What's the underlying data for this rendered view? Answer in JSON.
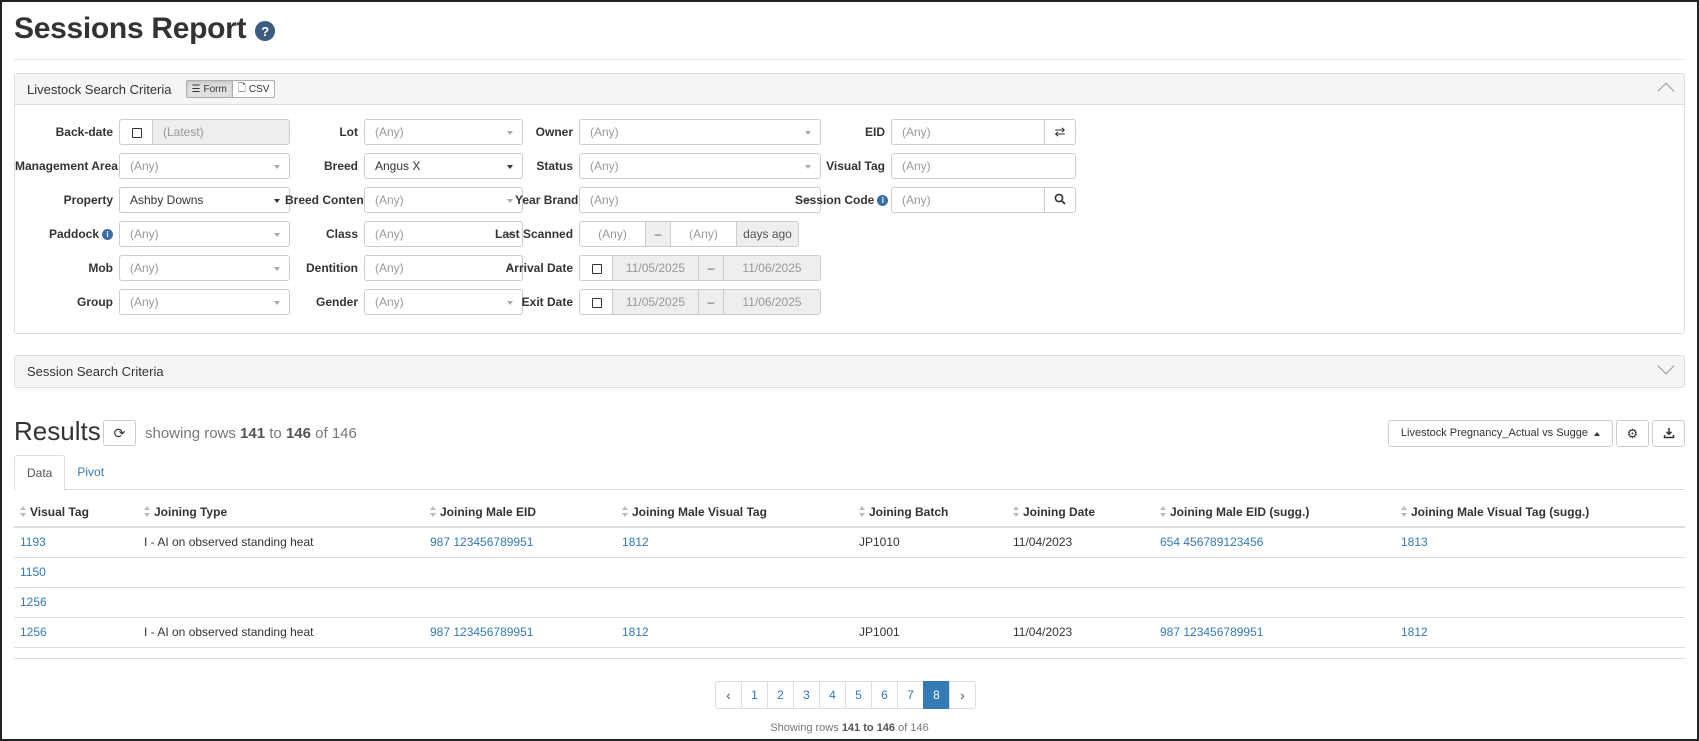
{
  "page": {
    "title": "Sessions Report",
    "help": "?"
  },
  "livestock_panel": {
    "title": "Livestock Search Criteria",
    "format_form": "Form",
    "format_csv": "CSV",
    "fields": {
      "backdate": {
        "label": "Back-date",
        "value": "(Latest)"
      },
      "management_area": {
        "label": "Management Area",
        "value": "(Any)"
      },
      "property": {
        "label": "Property",
        "value": "Ashby Downs"
      },
      "paddock": {
        "label": "Paddock",
        "value": "(Any)"
      },
      "mob": {
        "label": "Mob",
        "value": "(Any)"
      },
      "group": {
        "label": "Group",
        "value": "(Any)"
      },
      "lot": {
        "label": "Lot",
        "value": "(Any)"
      },
      "breed": {
        "label": "Breed",
        "value": "Angus X"
      },
      "breed_content": {
        "label": "Breed Content",
        "value": "(Any)"
      },
      "class": {
        "label": "Class",
        "value": "(Any)"
      },
      "dentition": {
        "label": "Dentition",
        "value": "(Any)"
      },
      "gender": {
        "label": "Gender",
        "value": "(Any)"
      },
      "owner": {
        "label": "Owner",
        "value": "(Any)"
      },
      "status": {
        "label": "Status",
        "value": "(Any)"
      },
      "year_brand": {
        "label": "Year Brand",
        "value": "(Any)"
      },
      "last_scanned": {
        "label": "Last Scanned",
        "from": "(Any)",
        "sep": "–",
        "to": "(Any)",
        "suffix": "days ago"
      },
      "arrival_date": {
        "label": "Arrival Date",
        "from": "11/05/2025",
        "sep": "–",
        "to": "11/06/2025"
      },
      "exit_date": {
        "label": "Exit Date",
        "from": "11/05/2025",
        "sep": "–",
        "to": "11/06/2025"
      },
      "eid": {
        "label": "EID",
        "placeholder": "(Any)"
      },
      "visual_tag": {
        "label": "Visual Tag",
        "placeholder": "(Any)"
      },
      "session_code": {
        "label": "Session Code",
        "placeholder": "(Any)"
      }
    }
  },
  "session_panel": {
    "title": "Session Search Criteria"
  },
  "results": {
    "title": "Results",
    "showing_prefix": "showing rows",
    "from": "141",
    "to_word": "to",
    "to": "146",
    "of_word": "of",
    "total": "146",
    "report_select": "Livestock Pregnancy_Actual vs Sugge",
    "tabs": [
      "Data",
      "Pivot"
    ],
    "columns": [
      "Visual Tag",
      "Joining Type",
      "Joining Male EID",
      "Joining Male Visual Tag",
      "Joining Batch",
      "Joining Date",
      "Joining Male EID (sugg.)",
      "Joining Male Visual Tag (sugg.)"
    ],
    "rows": [
      [
        "1193",
        "I - AI on observed standing heat",
        "987 123456789951",
        "1812",
        "JP1010",
        "11/04/2023",
        "654 456789123456",
        "1813"
      ],
      [
        "1150",
        "",
        "",
        "",
        "",
        "",
        "",
        ""
      ],
      [
        "1256",
        "",
        "",
        "",
        "",
        "",
        "",
        ""
      ],
      [
        "1256",
        "I - AI on observed standing heat",
        "987 123456789951",
        "1812",
        "JP1001",
        "11/04/2023",
        "987 123456789951",
        "1812"
      ]
    ]
  },
  "pagination": {
    "prev": "‹",
    "pages": [
      "1",
      "2",
      "3",
      "4",
      "5",
      "6",
      "7",
      "8"
    ],
    "active": "8",
    "next": "›",
    "footer_prefix": "Showing rows",
    "footer_from": "141",
    "footer_to_word": "to",
    "footer_to": "146",
    "footer_of_word": "of",
    "footer_total": "146"
  }
}
